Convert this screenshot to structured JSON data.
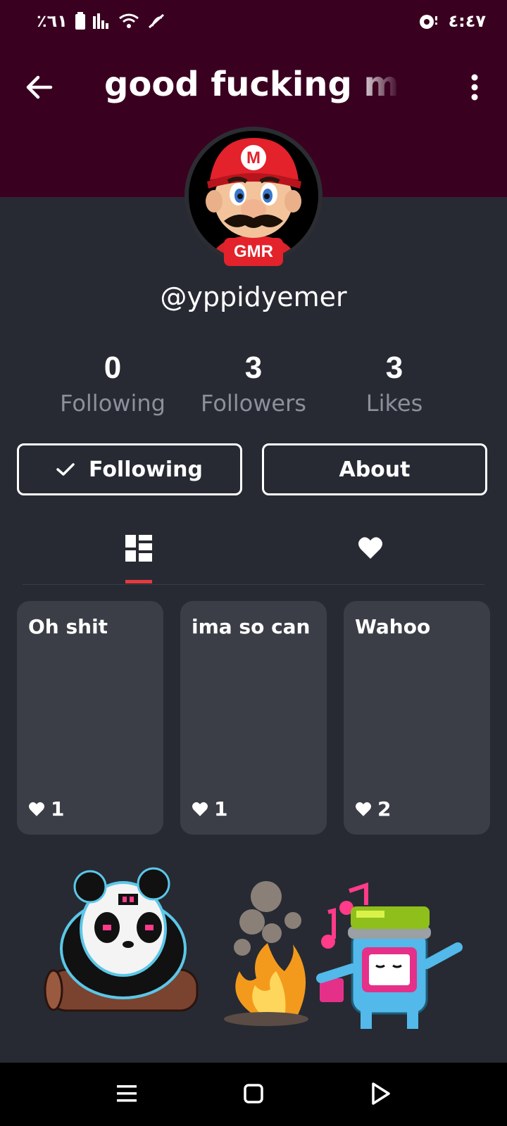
{
  "status_bar": {
    "battery_percent": "٪٦١",
    "time": "٤:٤٧"
  },
  "header": {
    "title": "good fucking mari"
  },
  "profile": {
    "avatar_badge": "GMR",
    "username": "@yppidyemer"
  },
  "stats": [
    {
      "value": "0",
      "label": "Following"
    },
    {
      "value": "3",
      "label": "Followers"
    },
    {
      "value": "3",
      "label": "Likes"
    }
  ],
  "actions": {
    "following_label": "Following",
    "about_label": "About"
  },
  "tabs": {
    "active": "posts",
    "icons": [
      "grid-icon",
      "heart-icon"
    ]
  },
  "posts": [
    {
      "title": "Oh shit",
      "likes": "1"
    },
    {
      "title": "ima so can",
      "likes": "1"
    },
    {
      "title": "Wahoo",
      "likes": "2"
    }
  ],
  "colors": {
    "header_bg": "#3a0020",
    "page_bg": "#272a33",
    "card_bg": "#3c3e47",
    "accent": "#e53a3f",
    "badge": "#e3222b"
  }
}
